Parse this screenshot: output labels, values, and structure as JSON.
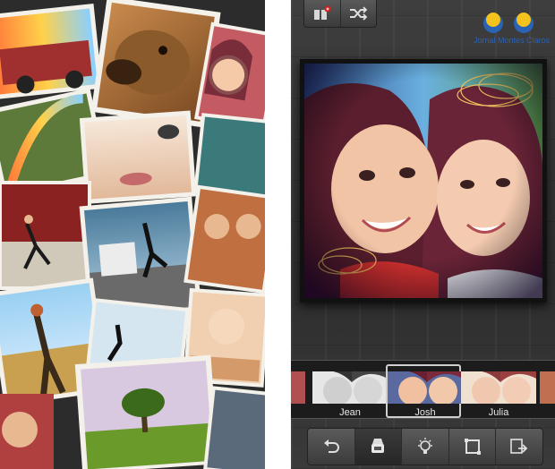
{
  "app": {
    "filters": [
      {
        "label": "Jean",
        "active": false
      },
      {
        "label": "Josh",
        "active": true
      },
      {
        "label": "Julia",
        "active": false
      }
    ],
    "toolbar_top": {
      "icons": [
        "add-photo-icon",
        "shuffle-icon"
      ]
    },
    "bottom_bar": {
      "icons": [
        "undo-icon",
        "filter-stamp-icon",
        "lightbulb-icon",
        "frame-icon",
        "share-icon"
      ],
      "active_index": 1
    }
  },
  "watermark": {
    "text": "Jornal Montes Claros"
  },
  "colors": {
    "wm_blue": "#2a62b4",
    "wm_yellow": "#f4c21c",
    "accent_red": "#d42020"
  }
}
